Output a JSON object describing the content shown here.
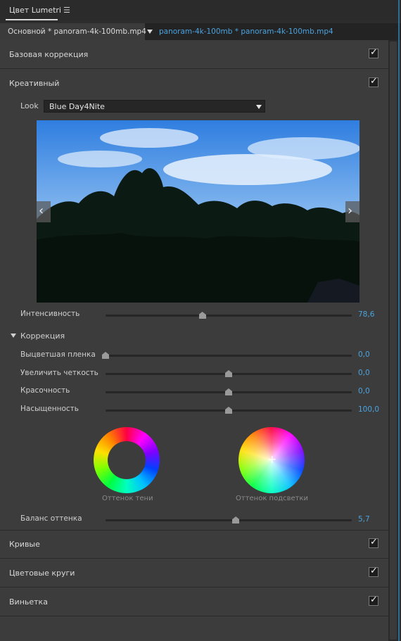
{
  "panel": {
    "title": "Цвет Lumetri",
    "menu_icon": "hamburger-menu-icon"
  },
  "clip_bar": {
    "master": "Основной * panoram-4k-100mb.mp4",
    "sequence": "panoram-4k-100mb * panoram-4k-100mb.mp4"
  },
  "sections": {
    "basic": {
      "label": "Базовая коррекция",
      "checked": true
    },
    "creative": {
      "label": "Креативный",
      "checked": true
    },
    "curves": {
      "label": "Кривые",
      "checked": true
    },
    "color_wheels": {
      "label": "Цветовые круги",
      "checked": true
    },
    "vignette": {
      "label": "Виньетка",
      "checked": true
    }
  },
  "creative": {
    "look_label": "Look",
    "look_value": "Blue Day4Nite",
    "nav_prev": "‹",
    "nav_next": "›",
    "intensity": {
      "label": "Интенсивность",
      "value": "78,6",
      "fraction": 0.393
    },
    "correction_label": "Коррекция",
    "faded_film": {
      "label": "Выцветшая пленка",
      "value": "0,0",
      "fraction": 0.0
    },
    "sharpen": {
      "label": "Увеличить четкость",
      "value": "0,0",
      "fraction": 0.5
    },
    "vibrance": {
      "label": "Красочность",
      "value": "0,0",
      "fraction": 0.5
    },
    "saturation": {
      "label": "Насыщенность",
      "value": "100,0",
      "fraction": 0.5
    },
    "shadow_tint_label": "Оттенок тени",
    "highlight_tint_label": "Оттенок подсветки",
    "tint_balance": {
      "label": "Баланс оттенка",
      "value": "5,7",
      "fraction": 0.529
    }
  },
  "colors": {
    "accent": "#4aa3df",
    "panel_bg": "#3c3c3c",
    "header_bg": "#2b2b2b"
  }
}
